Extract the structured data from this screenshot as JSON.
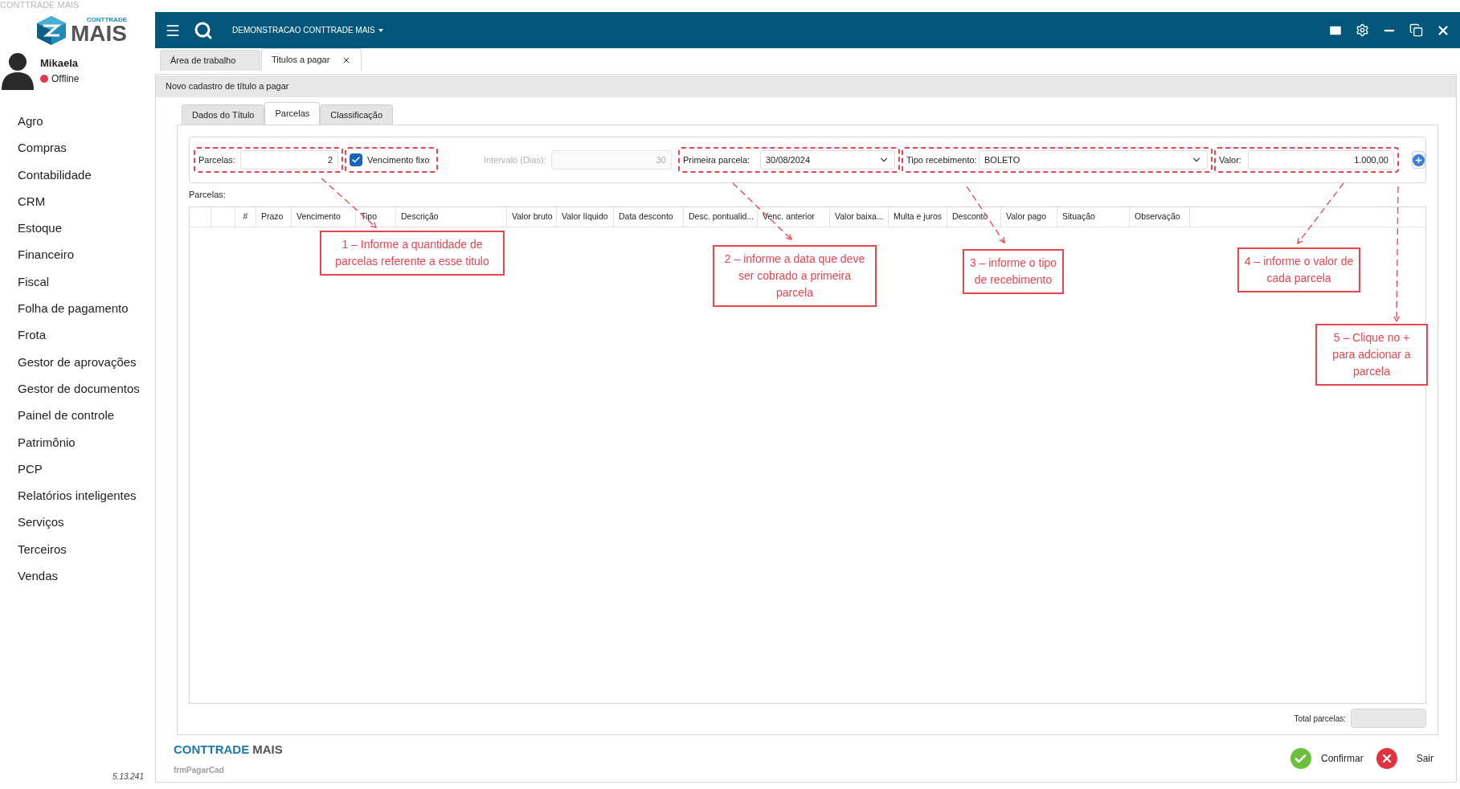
{
  "window": {
    "title": "CONTTRADE MAIS"
  },
  "logo": {
    "small": "CONTTRADE",
    "large": "MAIS"
  },
  "user": {
    "name": "Mikaela",
    "status": "Offline",
    "online": false
  },
  "menu": [
    "Agro",
    "Compras",
    "Contabilidade",
    "CRM",
    "Estoque",
    "Financeiro",
    "Fiscal",
    "Folha de pagamento",
    "Frota",
    "Gestor de aprovações",
    "Gestor de documentos",
    "Painel de controle",
    "Patrimônio",
    "PCP",
    "Relatórios inteligentes",
    "Serviços",
    "Terceiros",
    "Vendas"
  ],
  "version": "5.13.241",
  "topbar": {
    "company": "DEMONSTRACAO CONTTRADE MAIS"
  },
  "tabs": [
    {
      "label": "Área de trabalho",
      "selected": false,
      "closable": false
    },
    {
      "label": "Titulos a pagar",
      "selected": true,
      "closable": true
    }
  ],
  "form": {
    "title": "Novo cadastro de título a pagar",
    "tabs": [
      {
        "label": "Dados do Título",
        "selected": false
      },
      {
        "label": "Parcelas",
        "selected": true
      },
      {
        "label": "Classificação",
        "selected": false
      }
    ],
    "parcelas": {
      "label": "Parcelas:",
      "value": "2",
      "highlighted": true
    },
    "vencimento_fixo": {
      "label": "Vencimento fixo",
      "checked": true,
      "highlighted": true
    },
    "intervalo": {
      "label": "Intervalo (Dias):",
      "value": "30",
      "disabled": true,
      "highlighted": false
    },
    "primeira_parcela": {
      "label": "Primeira parcela:",
      "value": "30/08/2024",
      "highlighted": true
    },
    "tipo_recebimento": {
      "label": "Tipo recebimento:",
      "value": "BOLETO",
      "highlighted": true
    },
    "valor": {
      "label": "Valor:",
      "value": "1.000,00",
      "highlighted": true
    }
  },
  "table": {
    "label": "Parcelas:",
    "columns": [
      "#",
      "Prazo",
      "Vencimento",
      "Tipo",
      "Descrição",
      "Valor bruto",
      "Valor líquido",
      "Data desconto",
      "Desc. pontualid...",
      "Venc. anterior",
      "Valor baixa...",
      "Multa e juros",
      "Desconto",
      "Valor pago",
      "Situação",
      "Observação"
    ]
  },
  "total": {
    "label": "Total parcelas:"
  },
  "footer": {
    "brand_a": "CONTTRADE",
    "brand_b": "MAIS",
    "form_name": "frmPagarCad",
    "buttons": [
      {
        "label": "Confirmar",
        "kind": "confirm"
      },
      {
        "label": "Sair",
        "kind": "exit"
      }
    ]
  },
  "annotations": [
    {
      "text": "1 – Informe a quantidade de parcelas referente a esse titulo"
    },
    {
      "text": "2 – informe a data que deve ser cobrado a primeira parcela"
    },
    {
      "text": "3 – informe o tipo de recebimento"
    },
    {
      "text": "4 – informe o valor de cada parcela"
    },
    {
      "text": "5 – Clique no + para adcionar a parcela"
    }
  ]
}
